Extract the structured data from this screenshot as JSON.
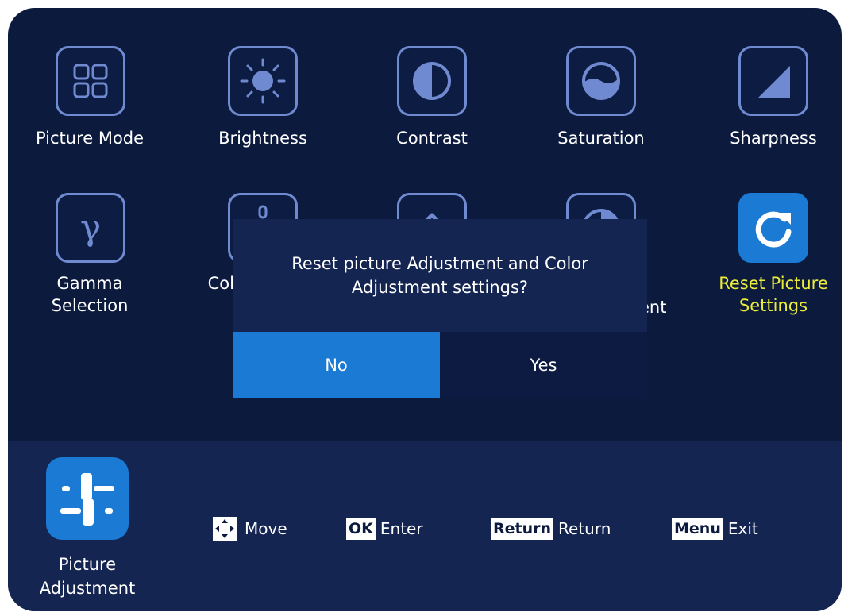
{
  "menu": {
    "items": [
      {
        "label": "Picture Mode",
        "icon": "picture-mode-grid-icon"
      },
      {
        "label": "Brightness",
        "icon": "brightness-sun-icon"
      },
      {
        "label": "Contrast",
        "icon": "contrast-half-circle-icon"
      },
      {
        "label": "Saturation",
        "icon": "saturation-wave-icon"
      },
      {
        "label": "Sharpness",
        "icon": "sharpness-triangle-icon"
      },
      {
        "label_line1": "Gamma",
        "label_line2": "Selection",
        "icon": "gamma-icon"
      },
      {
        "label_partial": "Col",
        "icon": "color-temperature-icon"
      },
      {
        "icon": "chevron-up-icon"
      },
      {
        "label_partial": "ent",
        "icon": "color-adjustment-icon"
      },
      {
        "label_line1": "Reset Picture",
        "label_line2": "Settings",
        "icon": "reset-arrow-icon",
        "selected": true
      }
    ]
  },
  "dialog": {
    "message_line1": "Reset picture Adjustment and Color",
    "message_line2": "Adjustment settings?",
    "no_label": "No",
    "yes_label": "Yes",
    "selected": "No"
  },
  "bottom_bar": {
    "section_line1": "Picture",
    "section_line2": "Adjustment",
    "hints": {
      "move_label": "Move",
      "ok_key": "OK",
      "ok_label": "Enter",
      "return_key": "Return",
      "return_label": "Return",
      "menu_key": "Menu",
      "menu_label": "Exit"
    }
  },
  "colors": {
    "background": "#0b1a3d",
    "panel": "#152552",
    "accent": "#1a7ad4",
    "selected_text": "#ecec3a",
    "icon_outline": "#6f8ad0"
  }
}
